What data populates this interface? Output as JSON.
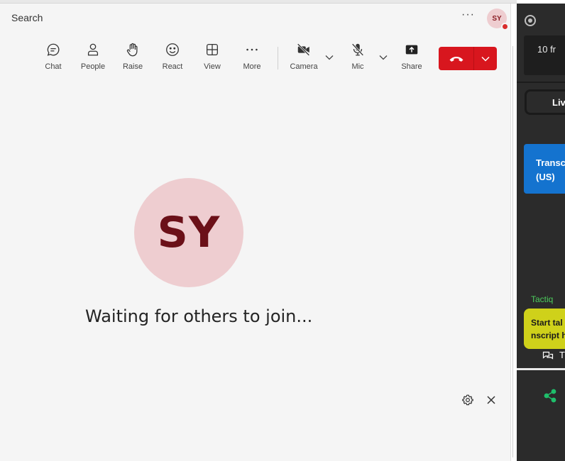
{
  "header": {
    "search_label": "Search",
    "more_glyph": "···",
    "user_initials": "SY"
  },
  "toolbar": {
    "chat": "Chat",
    "people": "People",
    "raise": "Raise",
    "react": "React",
    "view": "View",
    "more": "More",
    "camera": "Camera",
    "mic": "Mic",
    "share": "Share"
  },
  "stage": {
    "avatar_initials": "SY",
    "waiting_text": "Waiting for others to join..."
  },
  "side_panel": {
    "frame_text": "10 fr",
    "live_tab": "Liv",
    "transcript_line1": "Transc",
    "transcript_line2": "(US)",
    "tactiq_label": "Tactiq",
    "start_line1": "Start tal",
    "start_line2": "nscript h",
    "chat_label": "T"
  },
  "colors": {
    "leave_red": "#d8161e",
    "avatar_bg": "#eecdd0",
    "transcript_blue": "#1473cf",
    "tactiq_green": "#4ccc5c",
    "start_yellow": "#cfd11a",
    "share_green": "#1fbf6b"
  }
}
